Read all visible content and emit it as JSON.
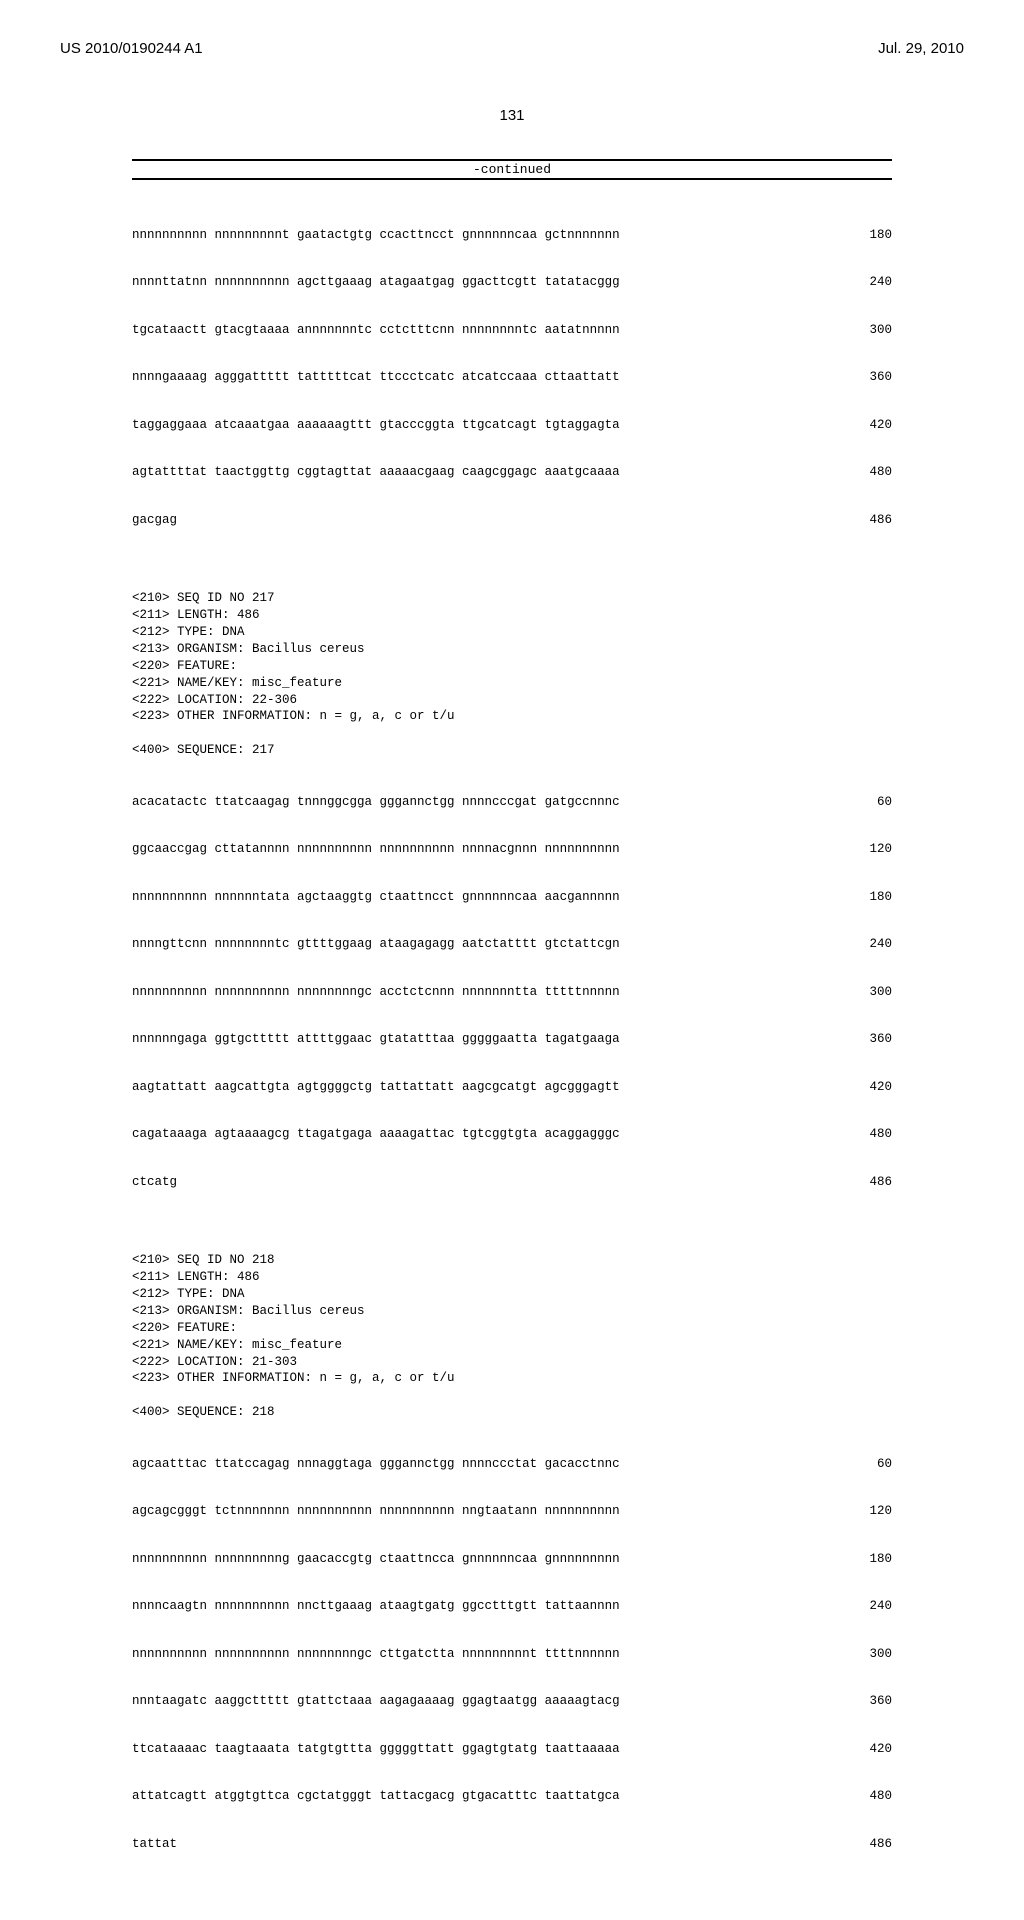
{
  "header": {
    "pub_number": "US 2010/0190244 A1",
    "pub_date": "Jul. 29, 2010"
  },
  "page_number": "131",
  "continued_label": "-continued",
  "seq216_tail": {
    "lines": [
      {
        "t": "nnnnnnnnnn nnnnnnnnnt gaatactgtg ccacttncct gnnnnnncaa gctnnnnnnn",
        "n": "180"
      },
      {
        "t": "nnnnttatnn nnnnnnnnnn agcttgaaag atagaatgag ggacttcgtt tatatacggg",
        "n": "240"
      },
      {
        "t": "tgcataactt gtacgtaaaa annnnnnntc cctctttcnn nnnnnnnntc aatatnnnnn",
        "n": "300"
      },
      {
        "t": "nnnngaaaag agggattttt tatttttcat ttccctcatc atcatccaaa cttaattatt",
        "n": "360"
      },
      {
        "t": "taggaggaaa atcaaatgaa aaaaaagttt gtacccggta ttgcatcagt tgtaggagta",
        "n": "420"
      },
      {
        "t": "agtattttat taactggttg cggtagttat aaaaacgaag caagcggagc aaatgcaaaa",
        "n": "480"
      },
      {
        "t": "gacgag",
        "n": "486"
      }
    ]
  },
  "seq217": {
    "header": "<210> SEQ ID NO 217\n<211> LENGTH: 486\n<212> TYPE: DNA\n<213> ORGANISM: Bacillus cereus\n<220> FEATURE:\n<221> NAME/KEY: misc_feature\n<222> LOCATION: 22-306\n<223> OTHER INFORMATION: n = g, a, c or t/u\n\n<400> SEQUENCE: 217",
    "lines": [
      {
        "t": "acacatactc ttatcaagag tnnnggcgga gggannctgg nnnncccgat gatgccnnnc",
        "n": "60"
      },
      {
        "t": "ggcaaccgag cttatannnn nnnnnnnnnn nnnnnnnnnn nnnnacgnnn nnnnnnnnnn",
        "n": "120"
      },
      {
        "t": "nnnnnnnnnn nnnnnntata agctaaggtg ctaattncct gnnnnnncaa aacgannnnn",
        "n": "180"
      },
      {
        "t": "nnnngttcnn nnnnnnnntc gttttggaag ataagagagg aatctatttt gtctattcgn",
        "n": "240"
      },
      {
        "t": "nnnnnnnnnn nnnnnnnnnn nnnnnnnngc acctctcnnn nnnnnnntta tttttnnnnn",
        "n": "300"
      },
      {
        "t": "nnnnnngaga ggtgcttttt attttggaac gtatatttaa gggggaatta tagatgaaga",
        "n": "360"
      },
      {
        "t": "aagtattatt aagcattgta agtggggctg tattattatt aagcgcatgt agcgggagtt",
        "n": "420"
      },
      {
        "t": "cagataaaga agtaaaagcg ttagatgaga aaaagattac tgtcggtgta acaggagggc",
        "n": "480"
      },
      {
        "t": "ctcatg",
        "n": "486"
      }
    ]
  },
  "seq218": {
    "header": "<210> SEQ ID NO 218\n<211> LENGTH: 486\n<212> TYPE: DNA\n<213> ORGANISM: Bacillus cereus\n<220> FEATURE:\n<221> NAME/KEY: misc_feature\n<222> LOCATION: 21-303\n<223> OTHER INFORMATION: n = g, a, c or t/u\n\n<400> SEQUENCE: 218",
    "lines": [
      {
        "t": "agcaatttac ttatccagag nnnaggtaga gggannctgg nnnnccctat gacacctnnc",
        "n": "60"
      },
      {
        "t": "agcagcgggt tctnnnnnnn nnnnnnnnnn nnnnnnnnnn nngtaatann nnnnnnnnnn",
        "n": "120"
      },
      {
        "t": "nnnnnnnnnn nnnnnnnnng gaacaccgtg ctaattncca gnnnnnncaa gnnnnnnnnn",
        "n": "180"
      },
      {
        "t": "nnnncaagtn nnnnnnnnnn nncttgaaag ataagtgatg ggcctttgtt tattaannnn",
        "n": "240"
      },
      {
        "t": "nnnnnnnnnn nnnnnnnnnn nnnnnnnngc cttgatctta nnnnnnnnnt ttttnnnnnn",
        "n": "300"
      },
      {
        "t": "nnntaagatc aaggcttttt gtattctaaa aagagaaaag ggagtaatgg aaaaagtacg",
        "n": "360"
      },
      {
        "t": "ttcataaaac taagtaaata tatgtgttta gggggttatt ggagtgtatg taattaaaaa",
        "n": "420"
      },
      {
        "t": "attatcagtt atggtgttca cgctatgggt tattacgacg gtgacatttc taattatgca",
        "n": "480"
      },
      {
        "t": "tattat",
        "n": "486"
      }
    ]
  }
}
